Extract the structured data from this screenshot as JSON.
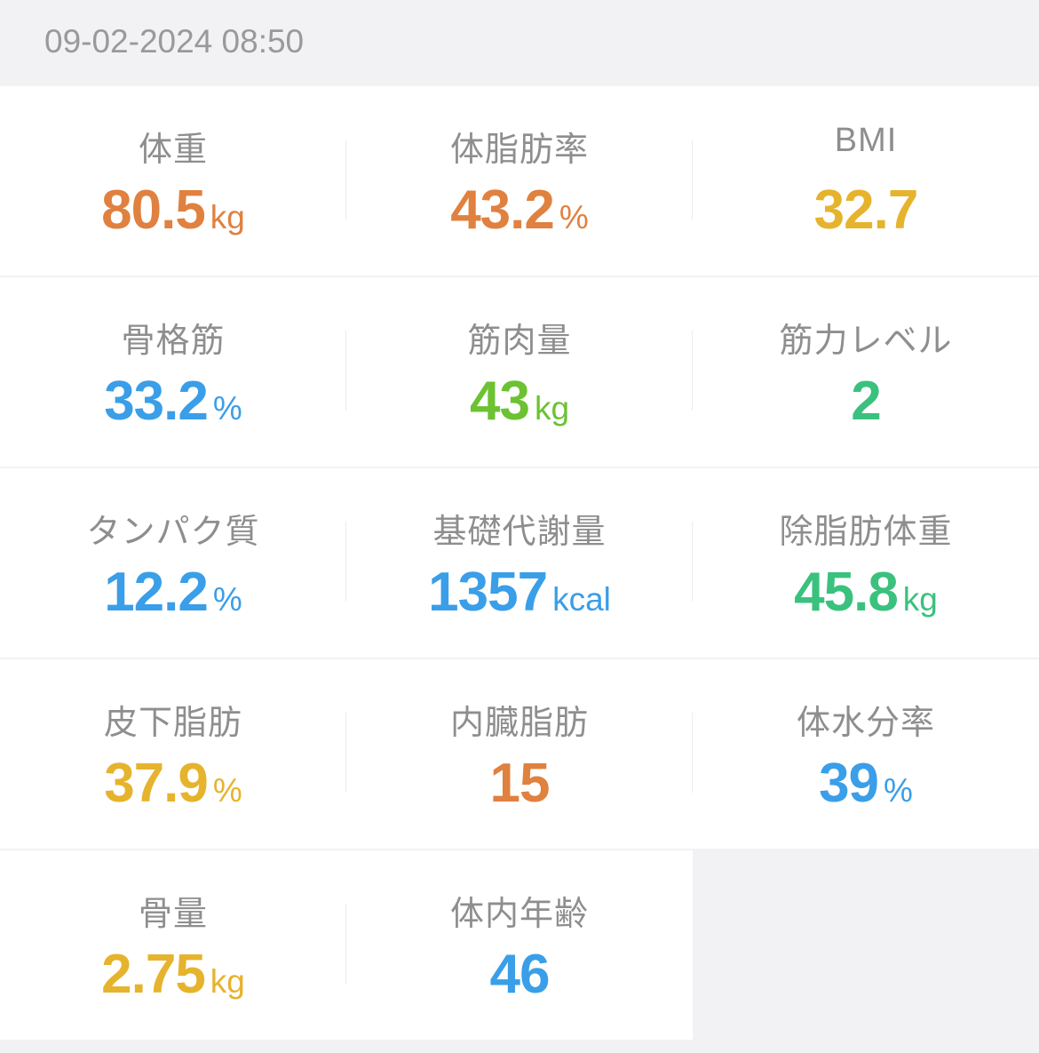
{
  "header": {
    "timestamp": "09-02-2024 08:50"
  },
  "colors": {
    "orange": "#e08140",
    "yellow": "#e6b32d",
    "blue": "#3a9ee8",
    "lime": "#6cc232",
    "green": "#3ac17e"
  },
  "metrics": [
    {
      "label": "体重",
      "value": "80.5",
      "unit": "kg",
      "color": "#e08140"
    },
    {
      "label": "体脂肪率",
      "value": "43.2",
      "unit": "%",
      "color": "#e08140"
    },
    {
      "label": "BMI",
      "value": "32.7",
      "unit": "",
      "color": "#e6b32d"
    },
    {
      "label": "骨格筋",
      "value": "33.2",
      "unit": "%",
      "color": "#3a9ee8"
    },
    {
      "label": "筋肉量",
      "value": "43",
      "unit": "kg",
      "color": "#6cc232"
    },
    {
      "label": "筋力レベル",
      "value": "2",
      "unit": "",
      "color": "#3ac17e"
    },
    {
      "label": "タンパク質",
      "value": "12.2",
      "unit": "%",
      "color": "#3a9ee8"
    },
    {
      "label": "基礎代謝量",
      "value": "1357",
      "unit": "kcal",
      "color": "#3a9ee8"
    },
    {
      "label": "除脂肪体重",
      "value": "45.8",
      "unit": "kg",
      "color": "#3ac17e"
    },
    {
      "label": "皮下脂肪",
      "value": "37.9",
      "unit": "%",
      "color": "#e6b32d"
    },
    {
      "label": "内臓脂肪",
      "value": "15",
      "unit": "",
      "color": "#e08140"
    },
    {
      "label": "体水分率",
      "value": "39",
      "unit": "%",
      "color": "#3a9ee8"
    },
    {
      "label": "骨量",
      "value": "2.75",
      "unit": "kg",
      "color": "#e6b32d"
    },
    {
      "label": "体内年齢",
      "value": "46",
      "unit": "",
      "color": "#3a9ee8"
    }
  ]
}
